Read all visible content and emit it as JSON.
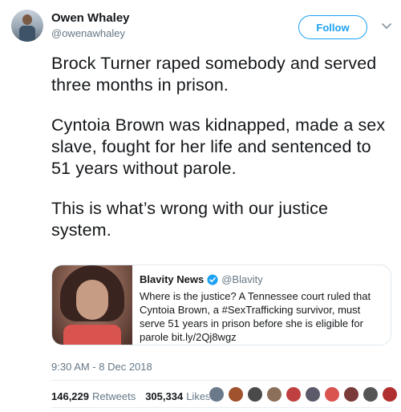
{
  "author": {
    "display_name": "Owen Whaley",
    "handle": "@owenawhaley",
    "avatar_icon": "user-avatar"
  },
  "follow_button_label": "Follow",
  "menu_icon": "chevron-down-icon",
  "tweet": {
    "paragraphs": [
      "Brock Turner raped somebody and served three months in prison.",
      "Cyntoia Brown was kidnapped, made a sex slave, fought for her life and sentenced to 51 years without parole.",
      "This is what’s wrong with our justice system."
    ]
  },
  "quoted_tweet": {
    "display_name": "Blavity News",
    "handle": "@Blavity",
    "verified": true,
    "text": "Where is the justice? A Tennessee court ruled that Cyntoia Brown, a #SexTrafficking survivor, must serve 51 years in prison before she is eligible for parole bit.ly/2Qj8wgz"
  },
  "timestamp": "9:30 AM - 8 Dec 2018",
  "stats": {
    "retweets_count": "146,229",
    "retweets_label": "Retweets",
    "likes_count": "305,334",
    "likes_label": "Likes"
  },
  "liker_avatar_colors": [
    "#6b7a8a",
    "#a0522d",
    "#4a4a4a",
    "#8b6f5a",
    "#c04040",
    "#5a5a6a",
    "#d9534f",
    "#7a3a3a",
    "#555555",
    "#b03030"
  ],
  "colors": {
    "accent": "#1da1f2",
    "text": "#14171a",
    "secondary_text": "#657786",
    "border": "#e1e8ed"
  }
}
